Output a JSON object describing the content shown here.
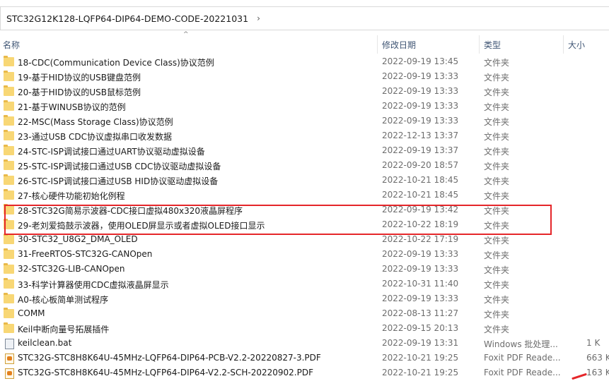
{
  "breadcrumb": {
    "path": "STC32G12K128-LQFP64-DIP64-DEMO-CODE-20221031",
    "chevron": "›"
  },
  "columns": {
    "name": "名称",
    "date": "修改日期",
    "type": "类型",
    "size": "大小",
    "sort_indicator": "^"
  },
  "rows": [
    {
      "name": "18-CDC(Communication Device Class)协议范例",
      "date": "2022-09-19 13:45",
      "type": "文件夹",
      "size": "",
      "icon": "folder-icon"
    },
    {
      "name": "19-基于HID协议的USB键盘范例",
      "date": "2022-09-19 13:33",
      "type": "文件夹",
      "size": "",
      "icon": "folder-icon"
    },
    {
      "name": "20-基于HID协议的USB鼠标范例",
      "date": "2022-09-19 13:33",
      "type": "文件夹",
      "size": "",
      "icon": "folder-icon"
    },
    {
      "name": "21-基于WINUSB协议的范例",
      "date": "2022-09-19 13:33",
      "type": "文件夹",
      "size": "",
      "icon": "folder-icon"
    },
    {
      "name": "22-MSC(Mass Storage Class)协议范例",
      "date": "2022-09-19 13:33",
      "type": "文件夹",
      "size": "",
      "icon": "folder-icon"
    },
    {
      "name": "23-通过USB CDC协议虚拟串口收发数据",
      "date": "2022-12-13 13:37",
      "type": "文件夹",
      "size": "",
      "icon": "folder-icon"
    },
    {
      "name": "24-STC-ISP调试接口通过UART协议驱动虚拟设备",
      "date": "2022-09-19 13:37",
      "type": "文件夹",
      "size": "",
      "icon": "folder-icon"
    },
    {
      "name": "25-STC-ISP调试接口通过USB CDC协议驱动虚拟设备",
      "date": "2022-09-20 18:57",
      "type": "文件夹",
      "size": "",
      "icon": "folder-icon"
    },
    {
      "name": "26-STC-ISP调试接口通过USB HID协议驱动虚拟设备",
      "date": "2022-10-21 18:45",
      "type": "文件夹",
      "size": "",
      "icon": "folder-icon"
    },
    {
      "name": "27-核心硬件功能初始化例程",
      "date": "2022-10-21 18:45",
      "type": "文件夹",
      "size": "",
      "icon": "folder-icon"
    },
    {
      "name": "28-STC32G简易示波器-CDC接口虚拟480x320液晶屏程序",
      "date": "2022-09-19 13:42",
      "type": "文件夹",
      "size": "",
      "icon": "folder-icon"
    },
    {
      "name": "29-老刘爱捣鼓示波器，使用OLED屏显示或者虚拟OLED接口显示",
      "date": "2022-10-22 18:19",
      "type": "文件夹",
      "size": "",
      "icon": "folder-icon"
    },
    {
      "name": "30-STC32_U8G2_DMA_OLED",
      "date": "2022-10-22 17:19",
      "type": "文件夹",
      "size": "",
      "icon": "folder-icon"
    },
    {
      "name": "31-FreeRTOS-STC32G-CANOpen",
      "date": "2022-09-19 13:33",
      "type": "文件夹",
      "size": "",
      "icon": "folder-icon"
    },
    {
      "name": "32-STC32G-LIB-CANOpen",
      "date": "2022-09-19 13:33",
      "type": "文件夹",
      "size": "",
      "icon": "folder-icon"
    },
    {
      "name": "33-科学计算器使用CDC虚拟液晶屏显示",
      "date": "2022-10-31 11:40",
      "type": "文件夹",
      "size": "",
      "icon": "folder-icon"
    },
    {
      "name": "A0-核心板简单测试程序",
      "date": "2022-09-19 13:33",
      "type": "文件夹",
      "size": "",
      "icon": "folder-icon"
    },
    {
      "name": "COMM",
      "date": "2022-08-13 11:27",
      "type": "文件夹",
      "size": "",
      "icon": "folder-icon"
    },
    {
      "name": "Keil中断向量号拓展插件",
      "date": "2022-09-15 20:13",
      "type": "文件夹",
      "size": "",
      "icon": "folder-icon"
    },
    {
      "name": "keilclean.bat",
      "date": "2022-09-19 13:31",
      "type": "Windows 批处理...",
      "size": "1 K",
      "icon": "batch-file-icon"
    },
    {
      "name": "STC32G-STC8H8K64U-45MHz-LQFP64-DIP64-PCB-V2.2-20220827-3.PDF",
      "date": "2022-10-21 19:25",
      "type": "Foxit PDF Reade...",
      "size": "663 K",
      "icon": "pdf-file-icon"
    },
    {
      "name": "STC32G-STC8H8K64U-45MHz-LQFP64-DIP64-V2.2-SCH-20220902.PDF",
      "date": "2022-10-21 19:25",
      "type": "Foxit PDF Reade...",
      "size": "163 K",
      "icon": "pdf-file-icon"
    }
  ],
  "colors": {
    "highlight": "#e5262a",
    "folder": "#f8d775",
    "header_text": "#3f5574"
  }
}
